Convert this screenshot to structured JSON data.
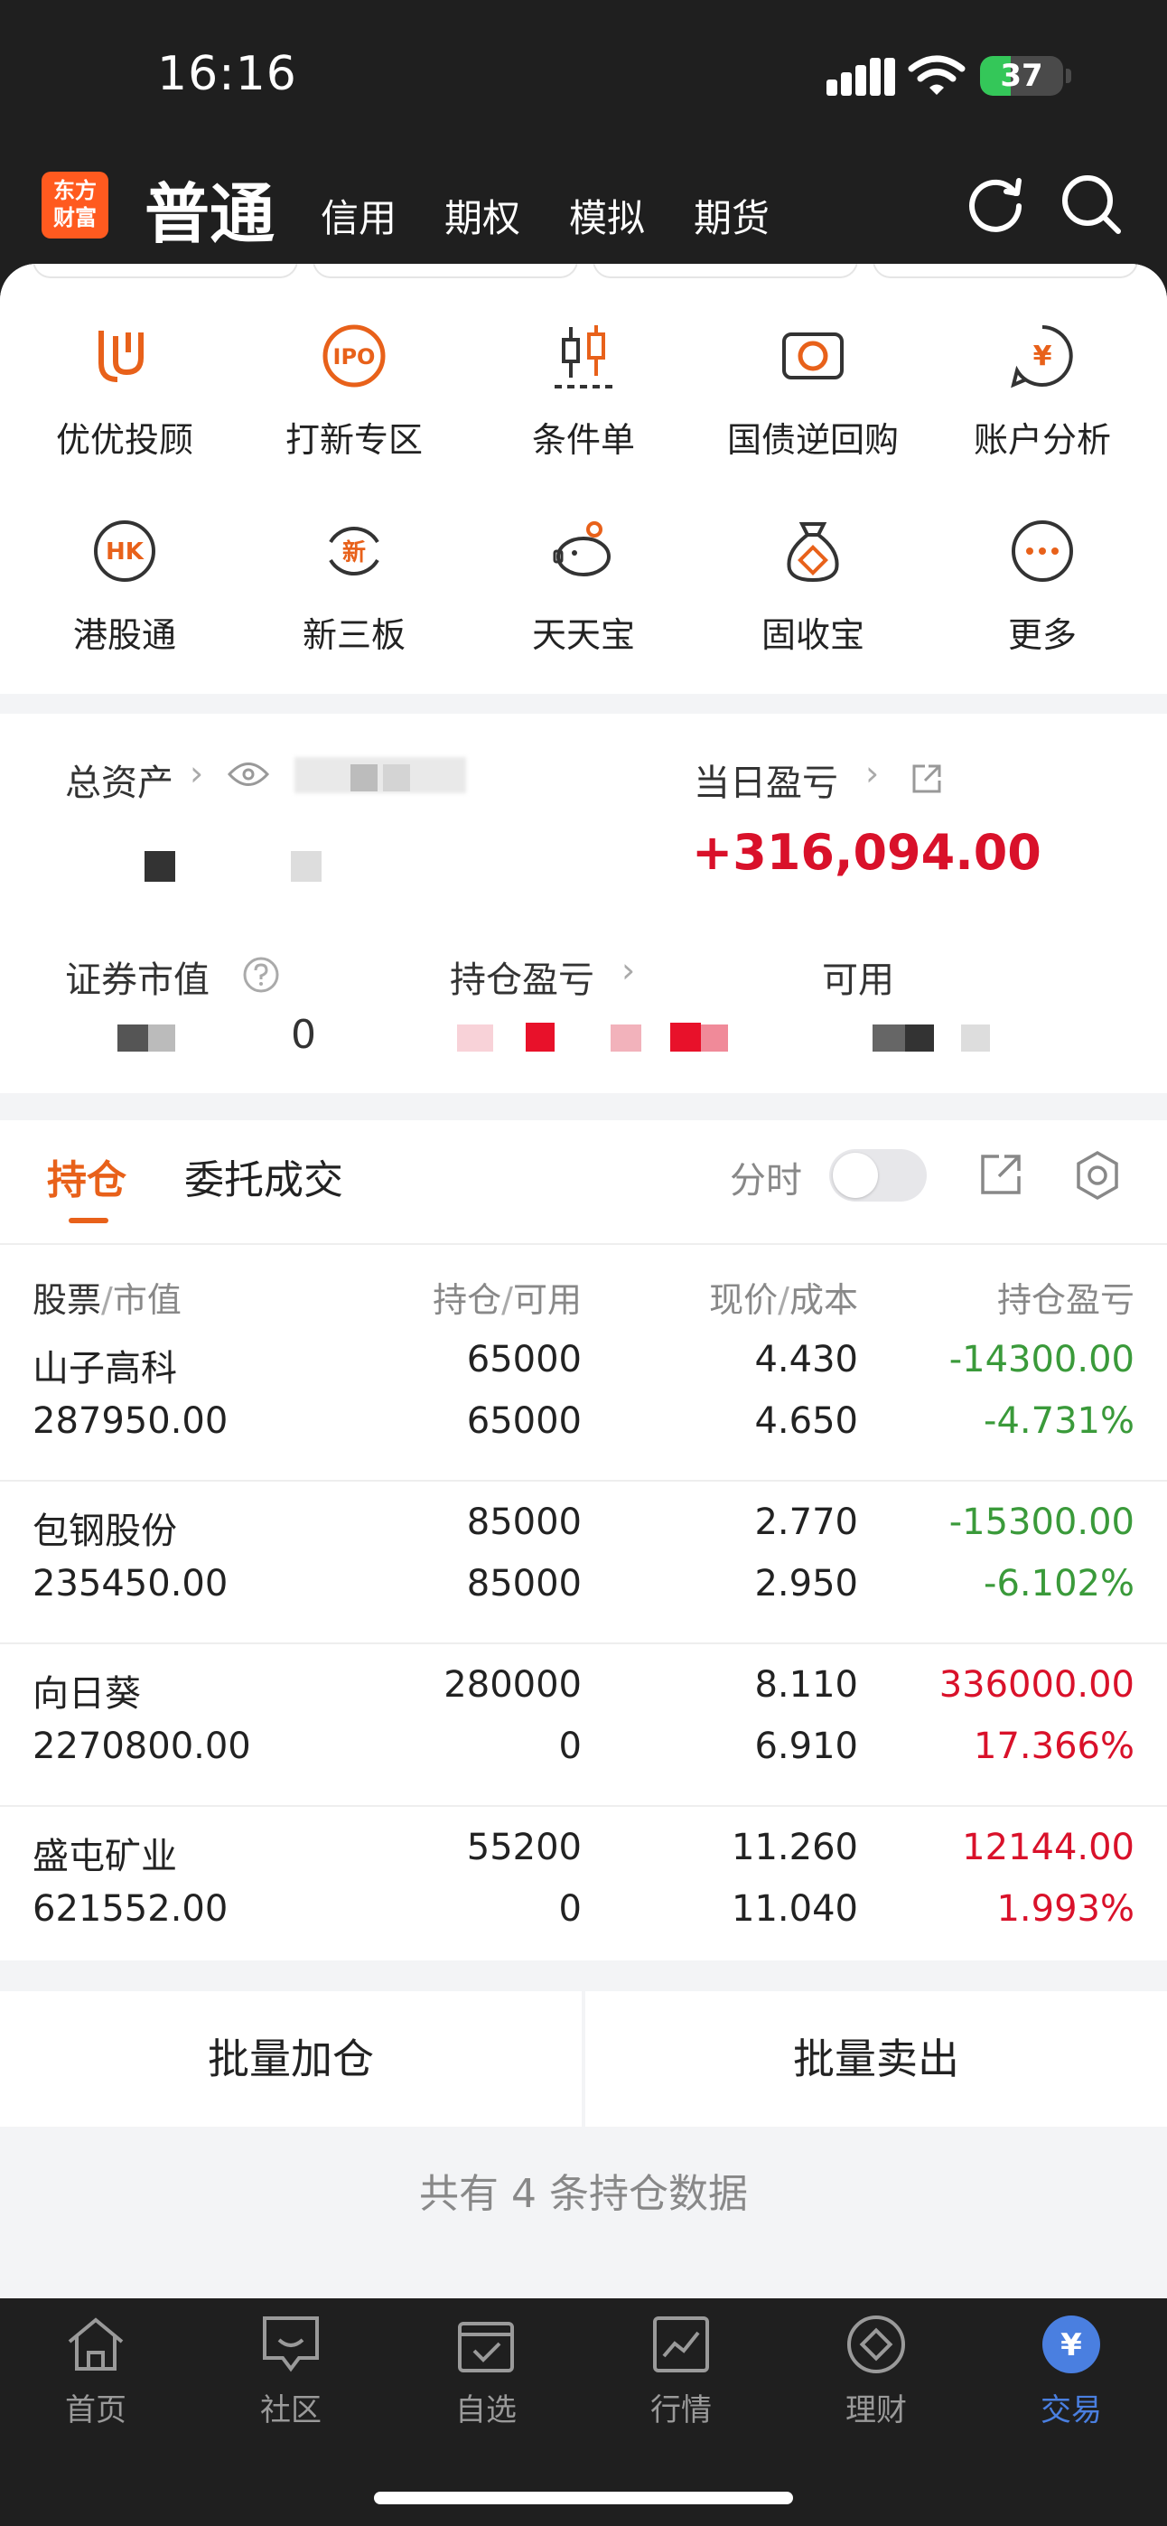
{
  "status": {
    "time": "16:16",
    "battery": "37",
    "battery_fraction": 0.37
  },
  "header": {
    "logo_line1": "东方",
    "logo_line2": "财富",
    "tabs": [
      "普通",
      "信用",
      "期权",
      "模拟",
      "期货"
    ]
  },
  "features": [
    {
      "label": "优优投顾",
      "icon": "uu-advisor-icon"
    },
    {
      "label": "打新专区",
      "icon": "ipo-icon",
      "icon_text": "IPO"
    },
    {
      "label": "条件单",
      "icon": "candlestick-icon"
    },
    {
      "label": "国债逆回购",
      "icon": "bond-repo-icon"
    },
    {
      "label": "账户分析",
      "icon": "account-analysis-icon",
      "icon_text": "¥"
    },
    {
      "label": "港股通",
      "icon": "hk-connect-icon",
      "icon_text": "HK"
    },
    {
      "label": "新三板",
      "icon": "neeq-icon",
      "icon_text": "新"
    },
    {
      "label": "天天宝",
      "icon": "piggy-bank-icon"
    },
    {
      "label": "固收宝",
      "icon": "money-bag-icon"
    },
    {
      "label": "更多",
      "icon": "more-icon"
    }
  ],
  "assets": {
    "total_label": "总资产",
    "daily_pnl_label": "当日盈亏",
    "daily_pnl_value": "+316,094.00",
    "securities_label": "证券市值",
    "securities_value_tail": "0",
    "holding_pnl_label": "持仓盈亏",
    "available_label": "可用"
  },
  "positions": {
    "tab_holdings": "持仓",
    "tab_orders": "委托成交",
    "toggle_label": "分时",
    "headers": {
      "stock": "股票",
      "market_value": "市值",
      "qty": "持仓",
      "avail": "可用",
      "price": "现价",
      "cost": "成本",
      "pnl": "持仓盈亏"
    },
    "rows": [
      {
        "name": "山子高科",
        "value": "287950.00",
        "qty": "65000",
        "avail": "65000",
        "price": "4.430",
        "cost": "4.650",
        "pnl": "-14300.00",
        "pct": "-4.731%",
        "color": "green"
      },
      {
        "name": "包钢股份",
        "value": "235450.00",
        "qty": "85000",
        "avail": "85000",
        "price": "2.770",
        "cost": "2.950",
        "pnl": "-15300.00",
        "pct": "-6.102%",
        "color": "green"
      },
      {
        "name": "向日葵",
        "value": "2270800.00",
        "qty": "280000",
        "avail": "0",
        "price": "8.110",
        "cost": "6.910",
        "pnl": "336000.00",
        "pct": "17.366%",
        "color": "red"
      },
      {
        "name": "盛屯矿业",
        "value": "621552.00",
        "qty": "55200",
        "avail": "0",
        "price": "11.260",
        "cost": "11.040",
        "pnl": "12144.00",
        "pct": "1.993%",
        "color": "red"
      }
    ],
    "batch_add": "批量加仓",
    "batch_sell": "批量卖出",
    "summary": "共有 4 条持仓数据"
  },
  "nav": [
    {
      "label": "首页",
      "icon": "home-icon"
    },
    {
      "label": "社区",
      "icon": "community-icon"
    },
    {
      "label": "自选",
      "icon": "watchlist-icon"
    },
    {
      "label": "行情",
      "icon": "market-icon"
    },
    {
      "label": "理财",
      "icon": "wealth-icon"
    },
    {
      "label": "交易",
      "icon": "trade-icon",
      "icon_text": "¥",
      "active": true
    }
  ],
  "colors": {
    "accent": "#e8611a",
    "up": "#d9112a",
    "down": "#3a9a3a",
    "nav_active": "#4a7fe0"
  }
}
